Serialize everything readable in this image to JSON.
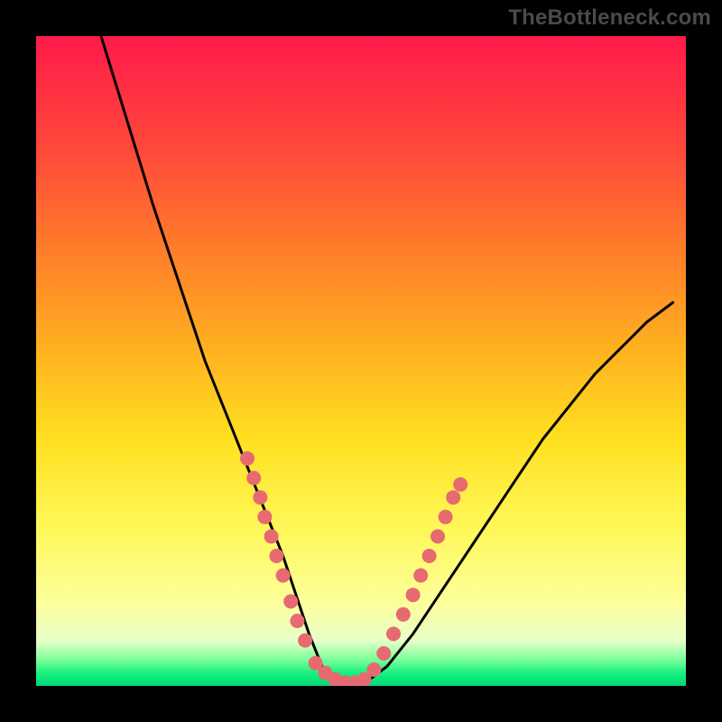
{
  "watermark": "TheBottleneck.com",
  "chart_data": {
    "type": "line",
    "title": "",
    "xlabel": "",
    "ylabel": "",
    "xlim": [
      0,
      100
    ],
    "ylim": [
      0,
      100
    ],
    "grid": false,
    "series": [
      {
        "name": "curve",
        "x": [
          10,
          14,
          18,
          22,
          26,
          30,
          34,
          38,
          40,
          42,
          44,
          46,
          50,
          54,
          58,
          62,
          66,
          70,
          74,
          78,
          82,
          86,
          90,
          94,
          98
        ],
        "y": [
          100,
          87,
          74,
          62,
          50,
          40,
          30,
          20,
          14,
          8,
          3,
          0,
          0,
          3,
          8,
          14,
          20,
          26,
          32,
          38,
          43,
          48,
          52,
          56,
          59
        ]
      }
    ],
    "points": [
      {
        "series": "left-cluster",
        "x": 32.5,
        "y": 35
      },
      {
        "series": "left-cluster",
        "x": 33.5,
        "y": 32
      },
      {
        "series": "left-cluster",
        "x": 34.5,
        "y": 29
      },
      {
        "series": "left-cluster",
        "x": 35.2,
        "y": 26
      },
      {
        "series": "left-cluster",
        "x": 36.2,
        "y": 23
      },
      {
        "series": "left-cluster",
        "x": 37.0,
        "y": 20
      },
      {
        "series": "left-cluster",
        "x": 38.0,
        "y": 17
      },
      {
        "series": "left-cluster",
        "x": 39.2,
        "y": 13
      },
      {
        "series": "left-cluster",
        "x": 40.2,
        "y": 10
      },
      {
        "series": "left-cluster",
        "x": 41.4,
        "y": 7
      },
      {
        "series": "bottom",
        "x": 43.0,
        "y": 3.5
      },
      {
        "series": "bottom",
        "x": 44.5,
        "y": 2
      },
      {
        "series": "bottom",
        "x": 46.0,
        "y": 1
      },
      {
        "series": "bottom",
        "x": 47.5,
        "y": 0.5
      },
      {
        "series": "bottom",
        "x": 49.0,
        "y": 0.5
      },
      {
        "series": "bottom",
        "x": 50.5,
        "y": 1
      },
      {
        "series": "bottom",
        "x": 52.0,
        "y": 2.5
      },
      {
        "series": "right-cluster",
        "x": 53.5,
        "y": 5
      },
      {
        "series": "right-cluster",
        "x": 55.0,
        "y": 8
      },
      {
        "series": "right-cluster",
        "x": 56.5,
        "y": 11
      },
      {
        "series": "right-cluster",
        "x": 58.0,
        "y": 14
      },
      {
        "series": "right-cluster",
        "x": 59.2,
        "y": 17
      },
      {
        "series": "right-cluster",
        "x": 60.5,
        "y": 20
      },
      {
        "series": "right-cluster",
        "x": 61.8,
        "y": 23
      },
      {
        "series": "right-cluster",
        "x": 63.0,
        "y": 26
      },
      {
        "series": "right-cluster",
        "x": 64.2,
        "y": 29
      },
      {
        "series": "right-cluster",
        "x": 65.3,
        "y": 31
      }
    ],
    "gradient_stops": [
      {
        "pos": 0,
        "color": "#ff1a4a"
      },
      {
        "pos": 18,
        "color": "#ff4a3a"
      },
      {
        "pos": 32,
        "color": "#ff7a2a"
      },
      {
        "pos": 48,
        "color": "#ffb020"
      },
      {
        "pos": 62,
        "color": "#ffe020"
      },
      {
        "pos": 76,
        "color": "#fff85a"
      },
      {
        "pos": 87,
        "color": "#fdff9a"
      },
      {
        "pos": 93,
        "color": "#e8ffc8"
      },
      {
        "pos": 96,
        "color": "#7aff9a"
      },
      {
        "pos": 98,
        "color": "#18f080"
      },
      {
        "pos": 100,
        "color": "#00d878"
      }
    ]
  }
}
